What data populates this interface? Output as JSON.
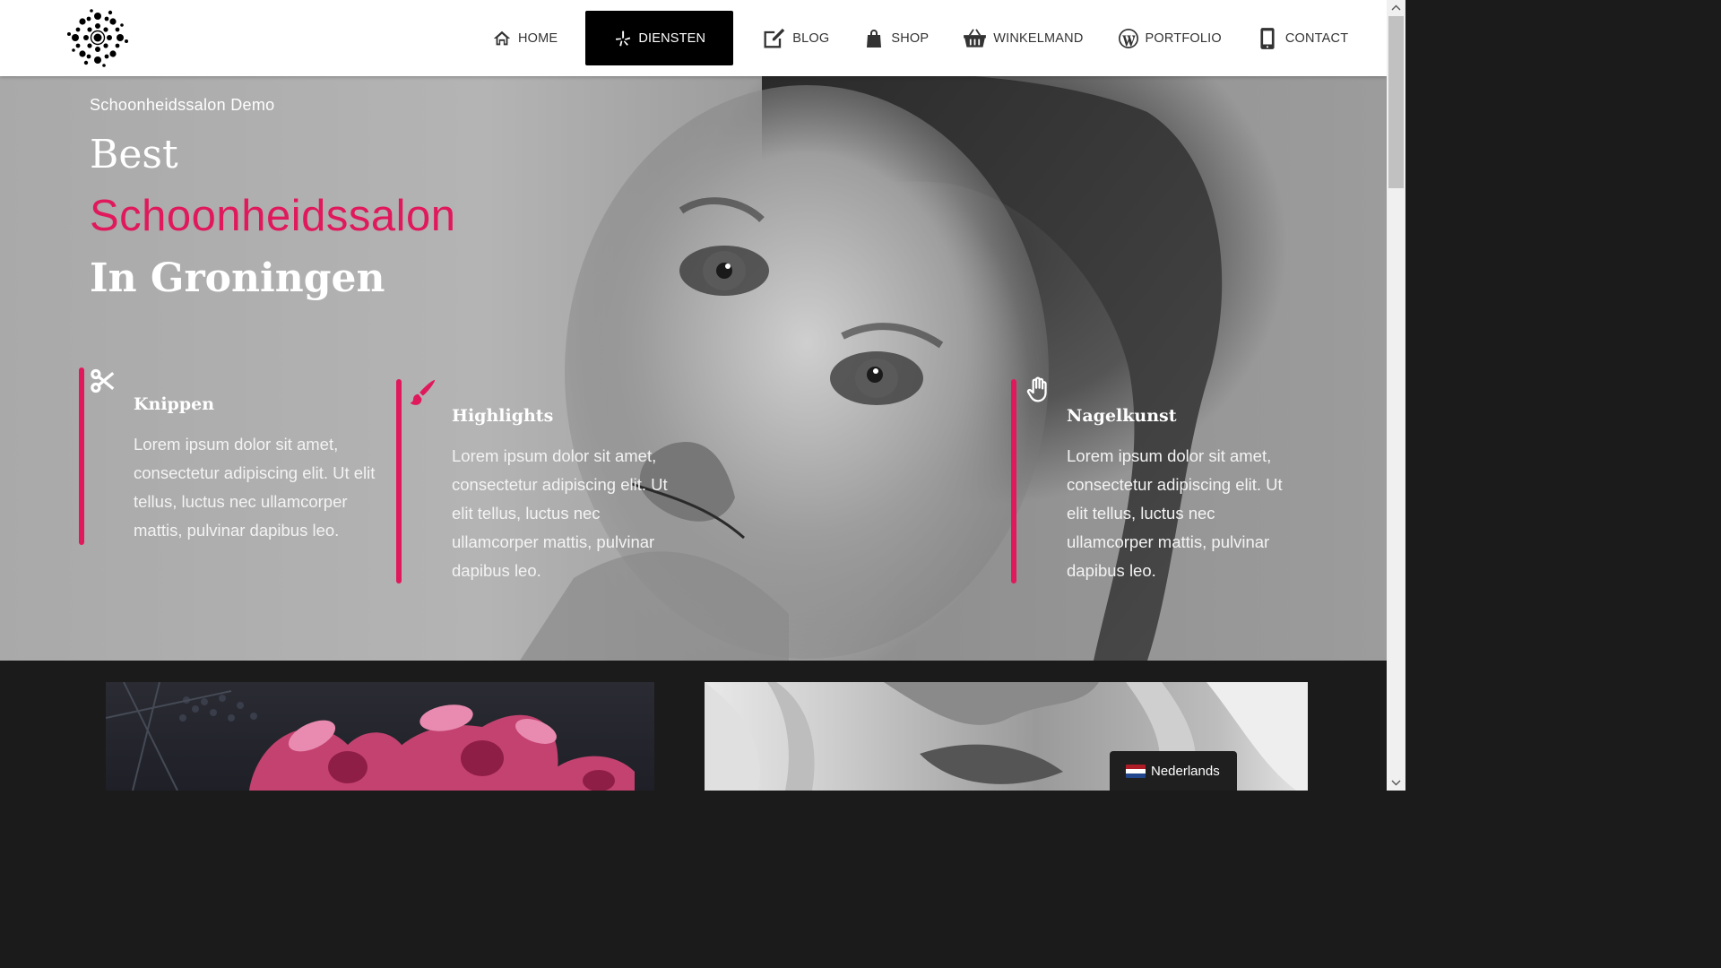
{
  "header": {
    "nav": [
      {
        "label": "HOME",
        "icon": "home-icon"
      },
      {
        "label": "DIENSTEN",
        "icon": "yelp-icon",
        "active": true
      },
      {
        "label": "BLOG",
        "icon": "edit-icon"
      },
      {
        "label": "SHOP",
        "icon": "shopping-bag-icon"
      },
      {
        "label": "WINKELMAND",
        "icon": "basket-icon"
      },
      {
        "label": "PORTFOLIO",
        "icon": "wordpress-icon"
      },
      {
        "label": "CONTACT",
        "icon": "mobile-icon"
      }
    ]
  },
  "hero": {
    "subtitle": "Schoonheidssalon Demo",
    "title_line1": "Best",
    "title_line2": "Schoonheidssalon",
    "title_line3": "In Groningen",
    "features": [
      {
        "title": "Knippen",
        "text": "Lorem ipsum dolor sit amet, consectetur adipiscing elit. Ut elit tellus, luctus nec ullamcorper mattis, pulvinar dapibus leo.",
        "icon": "scissors-icon"
      },
      {
        "title": "Highlights",
        "text": "Lorem ipsum dolor sit amet, consectetur adipiscing elit. Ut elit tellus, luctus nec ullamcorper mattis, pulvinar dapibus leo.",
        "icon": "paint-brush-icon"
      },
      {
        "title": "Nagelkunst",
        "text": "Lorem ipsum dolor sit amet, consectetur adipiscing elit. Ut elit tellus, luctus nec ullamcorper mattis, pulvinar dapibus leo.",
        "icon": "hand-icon"
      }
    ]
  },
  "language": {
    "label": "Nederlands",
    "flag": "netherlands-flag-icon"
  },
  "colors": {
    "accent": "#e0195c",
    "header_bg": "#ffffff",
    "active_nav_bg": "#000000",
    "bottom_bg": "#1b1b1b"
  }
}
